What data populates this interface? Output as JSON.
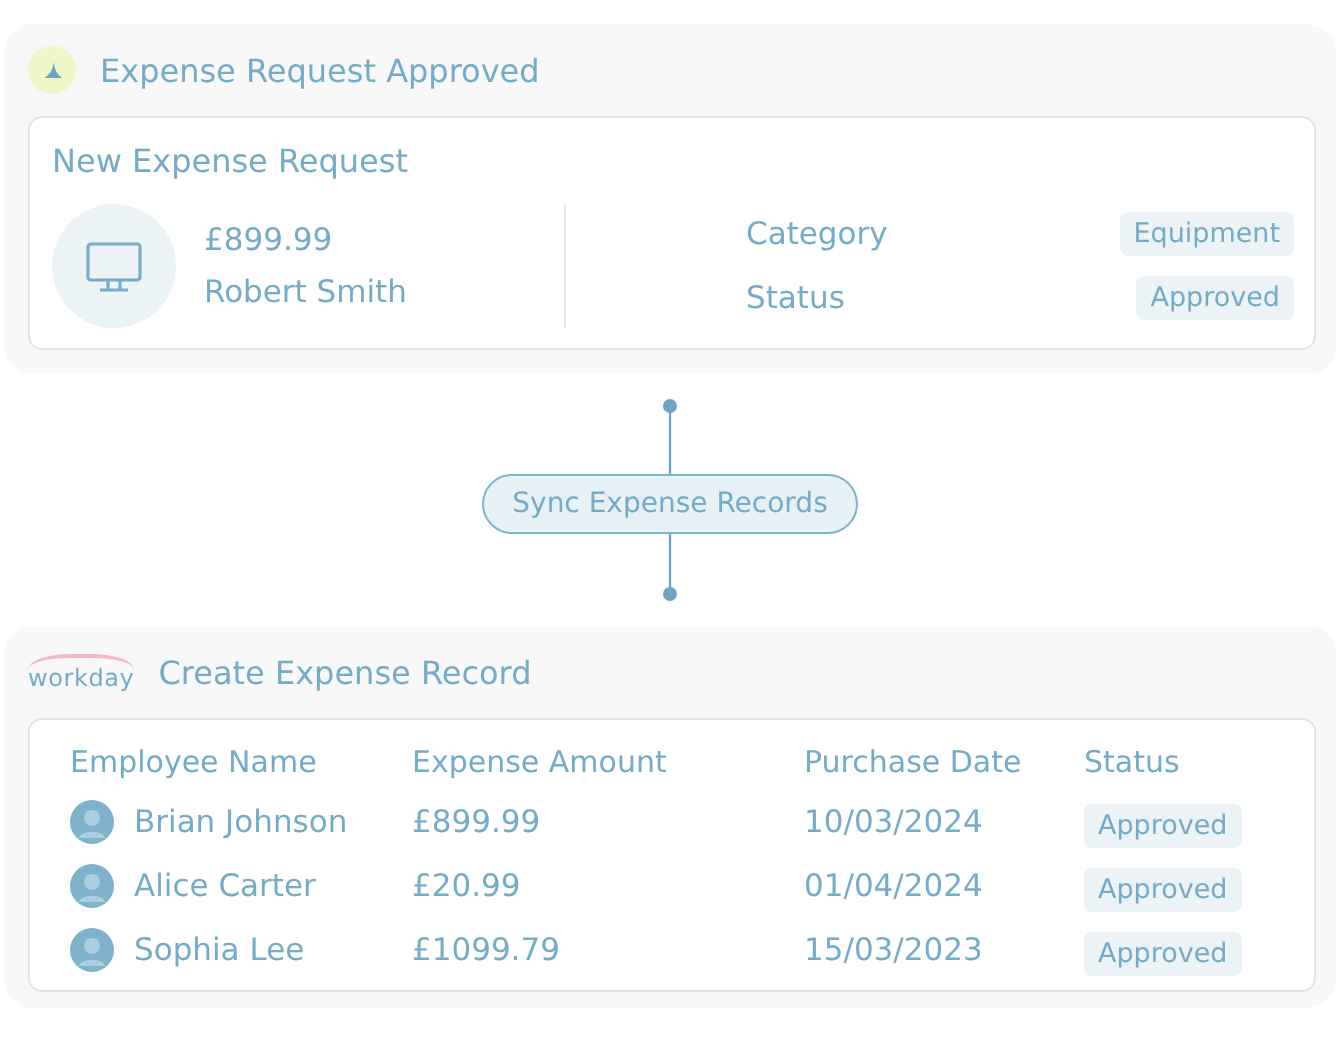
{
  "trigger": {
    "title": "Expense Request Approved",
    "card": {
      "title": "New Expense Request",
      "amount": "£899.99",
      "name": "Robert Smith",
      "fields": [
        {
          "label": "Category",
          "value": "Equipment"
        },
        {
          "label": "Status",
          "value": "Approved"
        }
      ]
    }
  },
  "connector": {
    "label": "Sync Expense Records"
  },
  "action": {
    "logo": "workday",
    "title": "Create Expense Record",
    "table": {
      "columns": [
        "Employee Name",
        "Expense Amount",
        "Purchase Date",
        "Status"
      ],
      "rows": [
        {
          "name": "Brian Johnson",
          "amount": "£899.99",
          "date": "10/03/2024",
          "status": "Approved"
        },
        {
          "name": "Alice Carter",
          "amount": "£20.99",
          "date": "01/04/2024",
          "status": "Approved"
        },
        {
          "name": "Sophia Lee",
          "amount": "£1099.79",
          "date": "15/03/2023",
          "status": "Approved"
        }
      ]
    }
  }
}
